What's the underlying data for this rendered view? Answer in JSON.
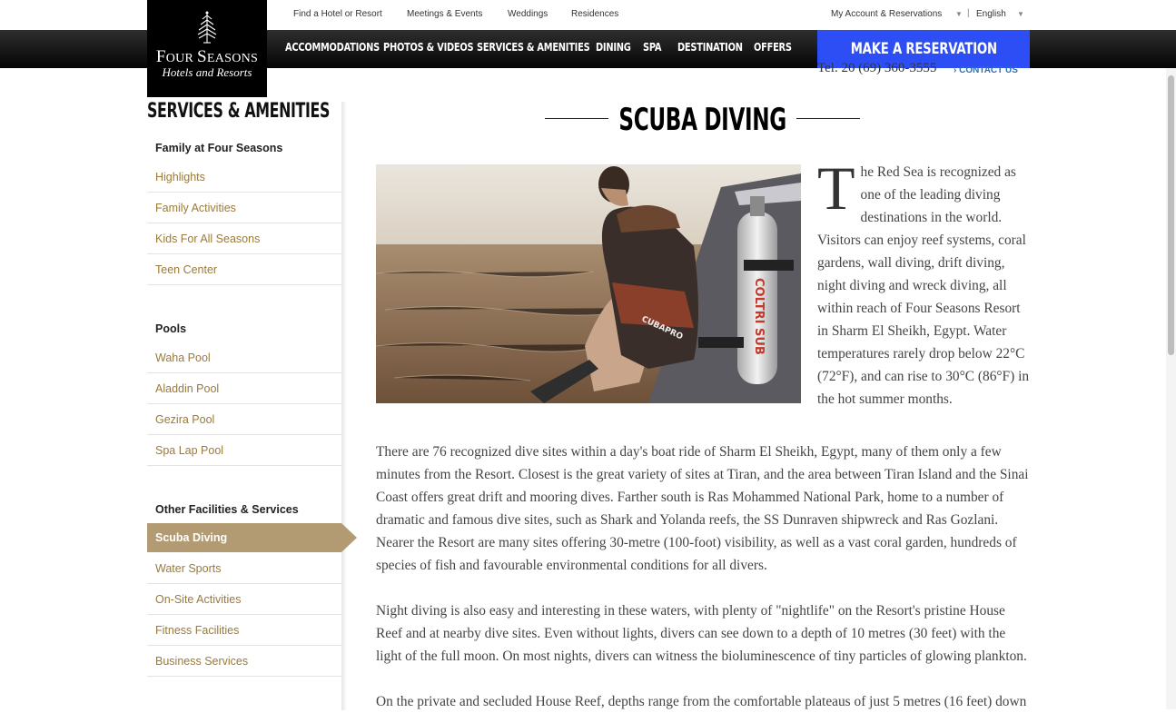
{
  "utility": {
    "links": [
      "Find a Hotel or Resort",
      "Meetings & Events",
      "Weddings",
      "Residences"
    ],
    "account": "My Account & Reservations",
    "separator": "|",
    "language": "English"
  },
  "logo": {
    "brand": "Four Seasons",
    "sub": "Hotels and Resorts"
  },
  "nav": {
    "items": [
      "ACCOMMODATIONS",
      "PHOTOS & VIDEOS",
      "SERVICES & AMENITIES",
      "DINING",
      "SPA",
      "DESTINATION",
      "OFFERS"
    ],
    "reserve": "MAKE A RESERVATION"
  },
  "phone": "Tel. 20 (69) 360-3555",
  "contact": "› CONTACT US",
  "sidebar": {
    "title": "SERVICES & AMENITIES",
    "sections": [
      {
        "heading": "Family at Four Seasons",
        "items": [
          "Highlights",
          "Family Activities",
          "Kids For All Seasons",
          "Teen Center"
        ]
      },
      {
        "heading": "Pools",
        "items": [
          "Waha Pool",
          "Aladdin Pool",
          "Gezira Pool",
          "Spa Lap Pool"
        ]
      },
      {
        "heading": "Other Facilities & Services",
        "items": [
          "Scuba Diving",
          "Water Sports",
          "On-Site Activities",
          "Fitness Facilities",
          "Business Services"
        ]
      }
    ],
    "active": "Scuba Diving"
  },
  "page": {
    "title": "SCUBA DIVING",
    "dropcap": "T",
    "intro": "he Red Sea is recognized as one of the leading diving destinations in the world. Visitors can enjoy reef systems, coral gardens, wall diving, drift diving, night diving and wreck diving, all within reach of Four Seasons Resort in Sharm El Sheikh, Egypt. Water temperatures rarely drop below 22°C (72°F), and can rise to 30°C (86°F) in the hot summer months.",
    "paragraphs": [
      "There are 76 recognized dive sites within a day's boat ride of Sharm El Sheikh, Egypt, many of them only a few minutes from the Resort. Closest is the great variety of sites at Tiran, and the area between Tiran Island and the Sinai Coast offers great drift and mooring dives. Farther south is Ras Mohammed National Park, home to a number of dramatic and famous dive sites, such as Shark and Yolanda reefs, the SS Dunraven shipwreck and Ras Gozlani. Nearer the Resort are many sites offering 30-metre (100-foot) visibility, as well as a vast coral garden, hundreds of species of fish and favourable environmental conditions for all divers.",
      "Night diving is also easy and interesting in these waters, with plenty of \"nightlife\" on the Resort's pristine House Reef and at nearby dive sites. Even without lights, divers can see down to a depth of 10 metres (30 feet) with the light of the full moon. On most nights, divers can witness the bioluminescence of tiny particles of glowing plankton.",
      "On the private and secluded House Reef, depths range from the comfortable plateaus of just 5 metres (16 feet) down"
    ],
    "photo_labels": {
      "tank": "COLTRI SUB",
      "vest": "CUBAPRO"
    }
  },
  "colors": {
    "accent_gold": "#9a7a3a",
    "active_bg": "#b29b72",
    "reserve_blue": "#2d4ef5",
    "link_blue": "#2d6fb0"
  }
}
